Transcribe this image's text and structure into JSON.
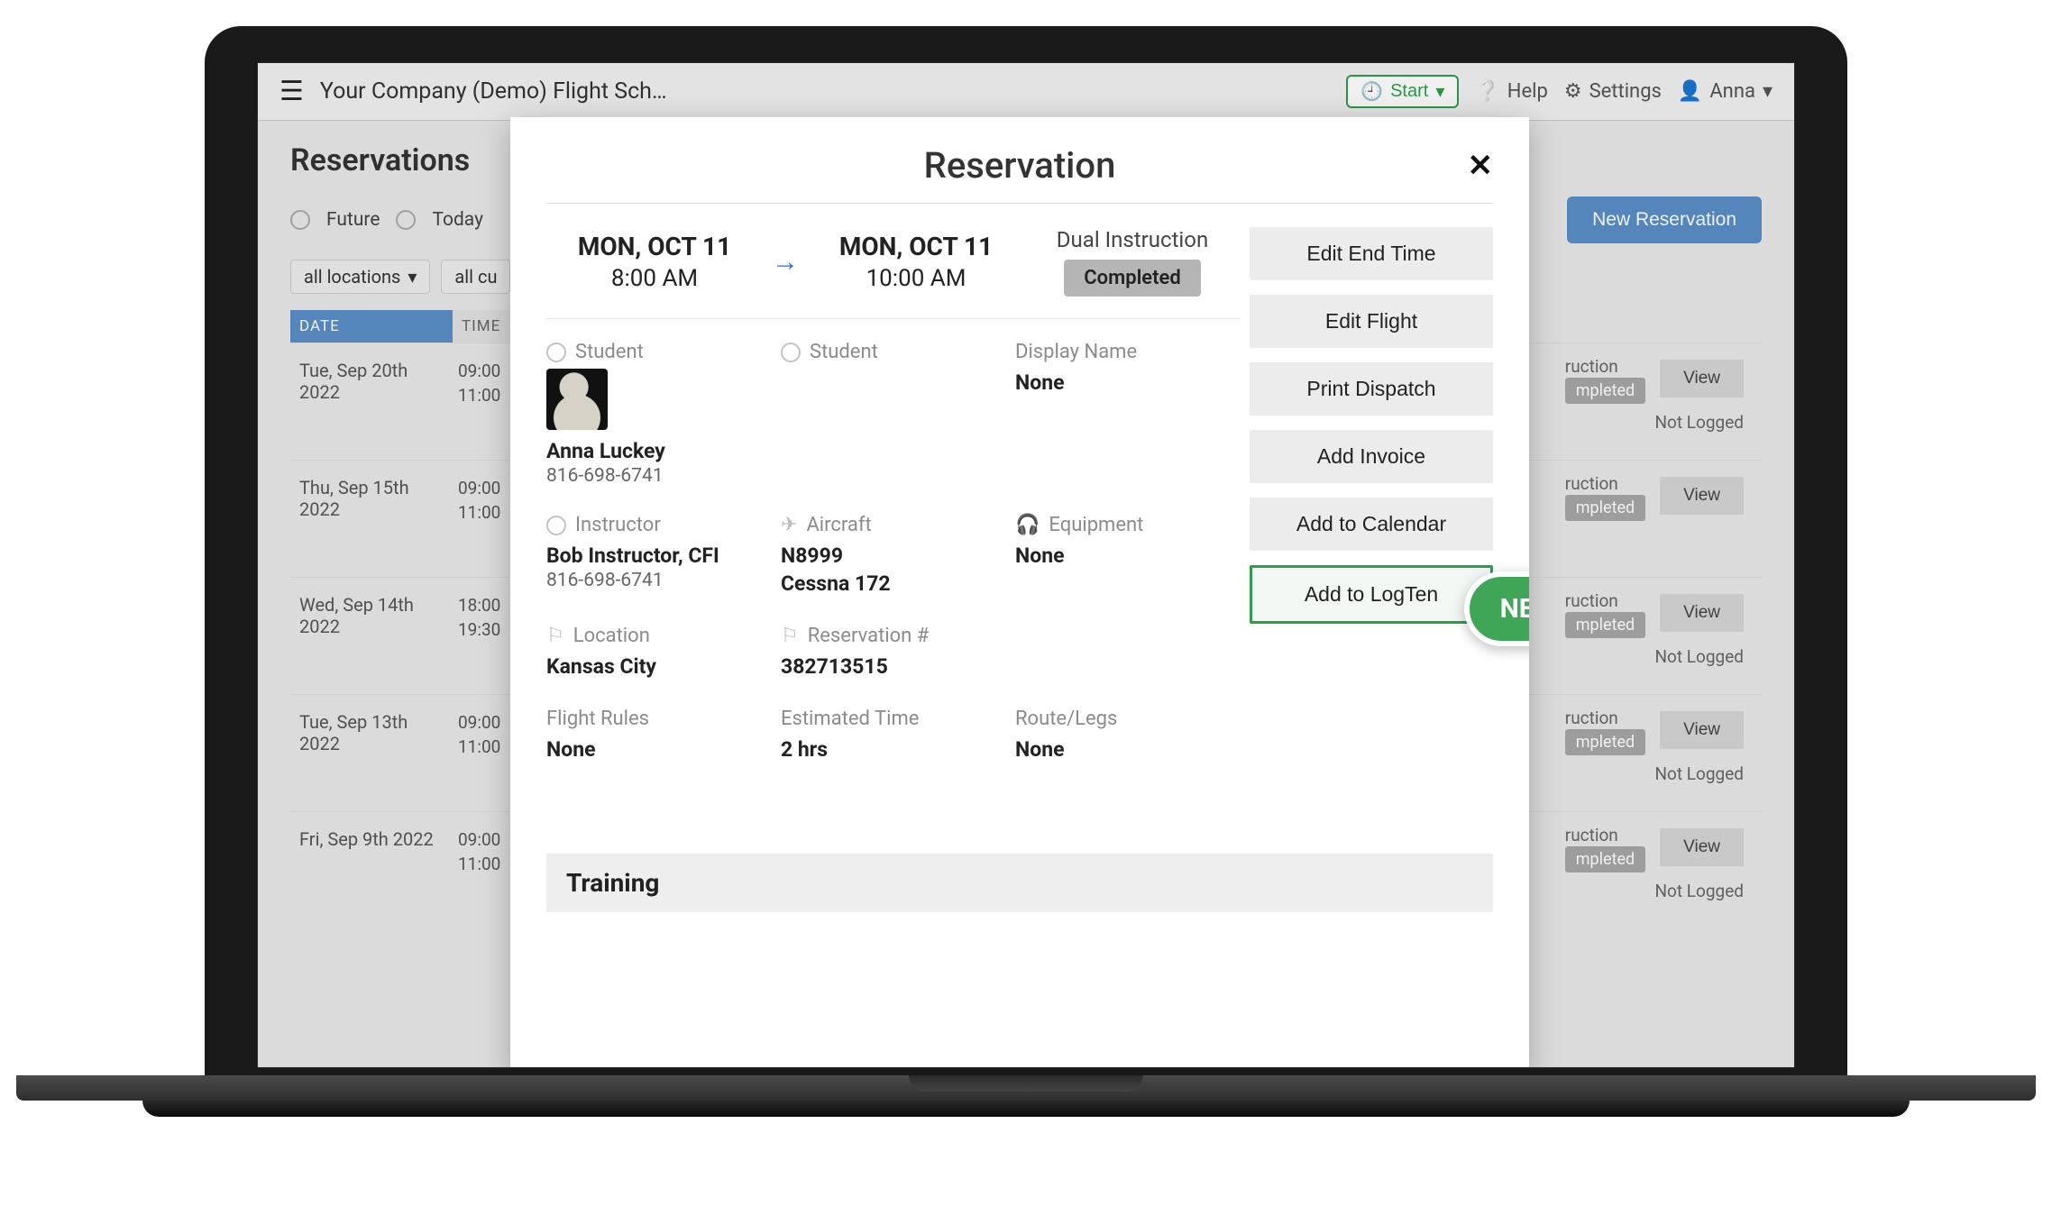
{
  "appbar": {
    "title": "Your Company (Demo) Flight Sch…",
    "start_label": "Start",
    "help_label": "Help",
    "settings_label": "Settings",
    "user_label": "Anna"
  },
  "page": {
    "title": "Reservations",
    "filters": {
      "future": "Future",
      "today": "Today",
      "all_locations": "all locations",
      "all_customers": "all cu"
    },
    "new_reservation_label": "New Reservation",
    "columns": {
      "date": "DATE",
      "time": "TIME"
    }
  },
  "rows": [
    {
      "date": "Tue, Sep 20th 2022",
      "time1": "09:00",
      "time2": "11:00",
      "status_top": "ruction",
      "badge": "mpleted",
      "status_bottom": "Not Logged",
      "view": "View"
    },
    {
      "date": "Thu, Sep 15th 2022",
      "time1": "09:00",
      "time2": "11:00",
      "status_top": "ruction",
      "badge": "mpleted",
      "status_bottom": "",
      "view": "View"
    },
    {
      "date": "Wed, Sep 14th 2022",
      "time1": "18:00",
      "time2": "19:30",
      "status_top": "ruction",
      "badge": "mpleted",
      "status_bottom": "Not Logged",
      "view": "View"
    },
    {
      "date": "Tue, Sep 13th 2022",
      "time1": "09:00",
      "time2": "11:00",
      "status_top": "ruction",
      "badge": "mpleted",
      "status_bottom": "Not Logged",
      "view": "View"
    },
    {
      "date": "Fri, Sep 9th 2022",
      "time1": "09:00",
      "time2": "11:00",
      "status_top": "ruction",
      "badge": "mpleted",
      "status_bottom": "Not Logged",
      "view": "View"
    }
  ],
  "modal": {
    "title": "Reservation",
    "start_date": "MON, OCT 11",
    "start_time": "8:00 AM",
    "end_date": "MON, OCT 11",
    "end_time": "10:00 AM",
    "type_label": "Dual Instruction",
    "status_badge": "Completed",
    "actions": {
      "edit_end_time": "Edit End Time",
      "edit_flight": "Edit Flight",
      "print_dispatch": "Print Dispatch",
      "add_invoice": "Add Invoice",
      "add_calendar": "Add to Calendar",
      "add_logten": "Add to LogTen"
    },
    "new_pill": "NEW!",
    "student1": {
      "label": "Student",
      "name": "Anna Luckey",
      "phone": "816-698-6741"
    },
    "student2": {
      "label": "Student"
    },
    "display_name": {
      "label": "Display Name",
      "value": "None"
    },
    "instructor": {
      "label": "Instructor",
      "name": "Bob Instructor, CFI",
      "phone": "816-698-6741"
    },
    "aircraft": {
      "label": "Aircraft",
      "tail": "N8999",
      "model": "Cessna 172"
    },
    "equipment": {
      "label": "Equipment",
      "value": "None"
    },
    "location": {
      "label": "Location",
      "value": "Kansas City"
    },
    "reservation_no": {
      "label": "Reservation #",
      "value": "382713515"
    },
    "flight_rules": {
      "label": "Flight Rules",
      "value": "None"
    },
    "est_time": {
      "label": "Estimated Time",
      "value": "2 hrs"
    },
    "route": {
      "label": "Route/Legs",
      "value": "None"
    },
    "training_header": "Training"
  }
}
